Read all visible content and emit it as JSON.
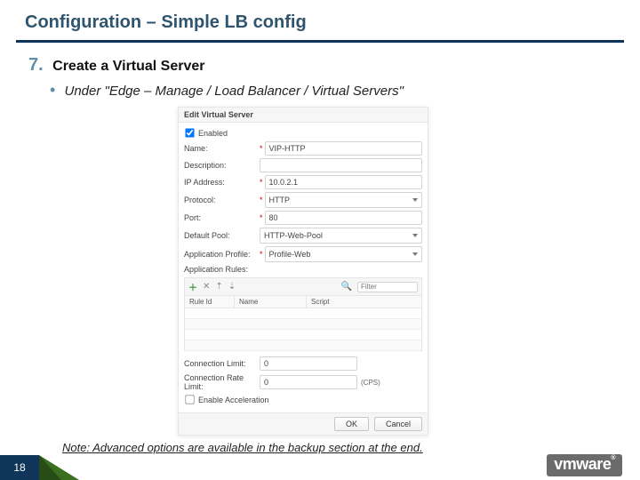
{
  "title": "Configuration – Simple LB config",
  "step_number": "7.",
  "step_text": "Create a Virtual Server",
  "sub_bullet": "•",
  "sub_text": "Under \"Edge – Manage /  Load Balancer /  Virtual Servers\"",
  "dialog": {
    "title": "Edit Virtual Server",
    "enabled_label": "Enabled",
    "rows": {
      "name_label": "Name:",
      "name_value": "VIP-HTTP",
      "desc_label": "Description:",
      "ip_label": "IP Address:",
      "ip_value": "10.0.2.1",
      "proto_label": "Protocol:",
      "proto_value": "HTTP",
      "port_label": "Port:",
      "port_value": "80",
      "pool_label": "Default Pool:",
      "pool_value": "HTTP-Web-Pool",
      "profile_label": "Application Profile:",
      "profile_value": "Profile-Web"
    },
    "rules_label": "Application Rules:",
    "rules_filter_placeholder": "Filter",
    "rules_headers": {
      "id": "Rule Id",
      "name": "Name",
      "script": "Script"
    },
    "conn_limit_label": "Connection Limit:",
    "conn_limit_value": "0",
    "rate_limit_label": "Connection Rate Limit:",
    "rate_limit_value": "0",
    "cps": "(CPS)",
    "accel_label": "Enable Acceleration",
    "ok": "OK",
    "cancel": "Cancel"
  },
  "note": "Note: Advanced options are available in the backup section at the end.",
  "page_number": "18",
  "logo": "vmware"
}
